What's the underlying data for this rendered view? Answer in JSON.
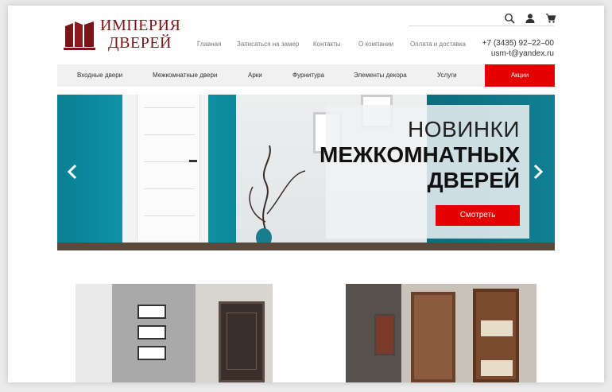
{
  "logo": {
    "line1": "ИМПЕРИЯ",
    "line2": "ДВЕРЕЙ"
  },
  "header": {
    "icons": [
      "search-icon",
      "user-icon",
      "cart-icon"
    ],
    "nav": [
      "Главная",
      "Записаться на замер",
      "Контакты",
      "О компании",
      "Оплата и доставка"
    ],
    "phone": "+7 (3435) 92–22–00",
    "email": "usm-t@yandex.ru"
  },
  "menu": {
    "items": [
      "Входные двери",
      "Межкомнатные двери",
      "Арки",
      "Фурнитура",
      "Элементы декора",
      "Услуги"
    ],
    "promo": "Акции"
  },
  "hero": {
    "line1": "НОВИНКИ",
    "line2": "МЕЖКОМНАТНЫХ",
    "line3": "ДВЕРЕЙ",
    "cta": "Смотреть"
  },
  "colors": {
    "brand": "#7b1416",
    "accent": "#e40000",
    "teal": "#139eb2"
  }
}
